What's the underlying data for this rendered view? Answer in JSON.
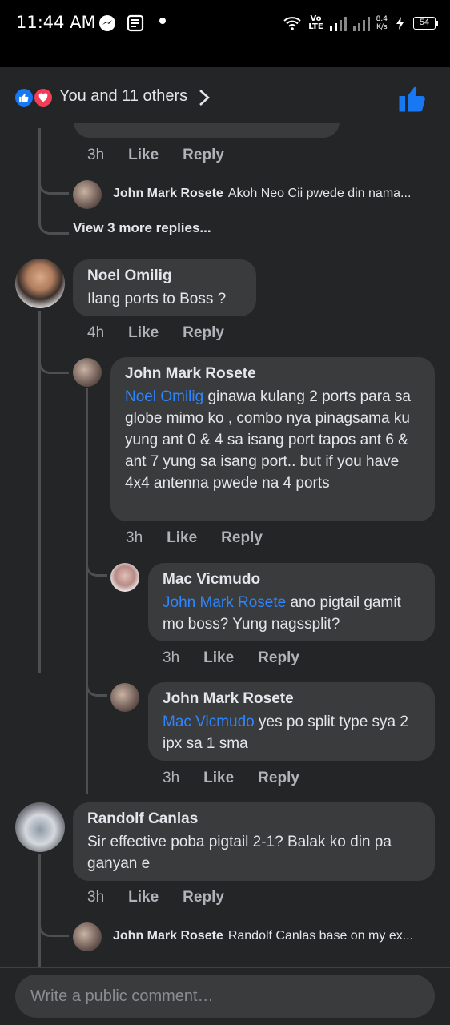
{
  "status_bar": {
    "time": "11:44 AM",
    "network": "Vo\nLTE",
    "speed_value": "8.4",
    "speed_unit": "K/s",
    "battery": "54",
    "icons": [
      "messenger-icon",
      "news-icon",
      "wifi-icon",
      "signal-icon",
      "charging-icon"
    ]
  },
  "reactions": {
    "summary": "You and 11 others",
    "icons": [
      "like-reaction-icon",
      "love-reaction-icon",
      "chevron-right-icon",
      "like-button-icon"
    ],
    "colors": {
      "like": "#1877f2",
      "love": "#f33e58"
    }
  },
  "comments": {
    "c0": {
      "time": "3h",
      "like": "Like",
      "reply": "Reply"
    },
    "c0_reply": {
      "author": "John Mark Rosete",
      "preview": "Akoh Neo Cii pwede din nama..."
    },
    "c0_view_more": "View 3 more replies...",
    "c1": {
      "author": "Noel Omilig",
      "text": "Ilang ports to Boss ?",
      "time": "4h",
      "like": "Like",
      "reply": "Reply"
    },
    "c1_r1": {
      "author": "John Mark Rosete",
      "mention": "Noel Omilig",
      "text": " ginawa kulang 2 ports para sa  globe mimo ko , combo nya pinagsama ku yung ant 0 & 4  sa isang port tapos ant 6 & ant 7 yung sa isang port.. but if you have 4x4  antenna pwede na 4 ports",
      "time": "3h",
      "like": "Like",
      "reply": "Reply"
    },
    "c1_r2": {
      "author": "Mac Vicmudo",
      "mention": "John Mark Rosete",
      "text": " ano pigtail gamit mo boss? Yung nagssplit?",
      "time": "3h",
      "like": "Like",
      "reply": "Reply"
    },
    "c1_r3": {
      "author": "John Mark Rosete",
      "mention": "Mac Vicmudo",
      "text": " yes po split type sya 2 ipx sa 1 sma",
      "time": "3h",
      "like": "Like",
      "reply": "Reply"
    },
    "c2": {
      "author": "Randolf Canlas",
      "text": "Sir effective poba pigtail  2-1? Balak ko din pa ganyan e",
      "time": "3h",
      "like": "Like",
      "reply": "Reply"
    },
    "c2_reply": {
      "author": "John Mark Rosete",
      "preview": "Randolf Canlas base on my ex..."
    }
  },
  "composer": {
    "placeholder": "Write a public comment…"
  }
}
